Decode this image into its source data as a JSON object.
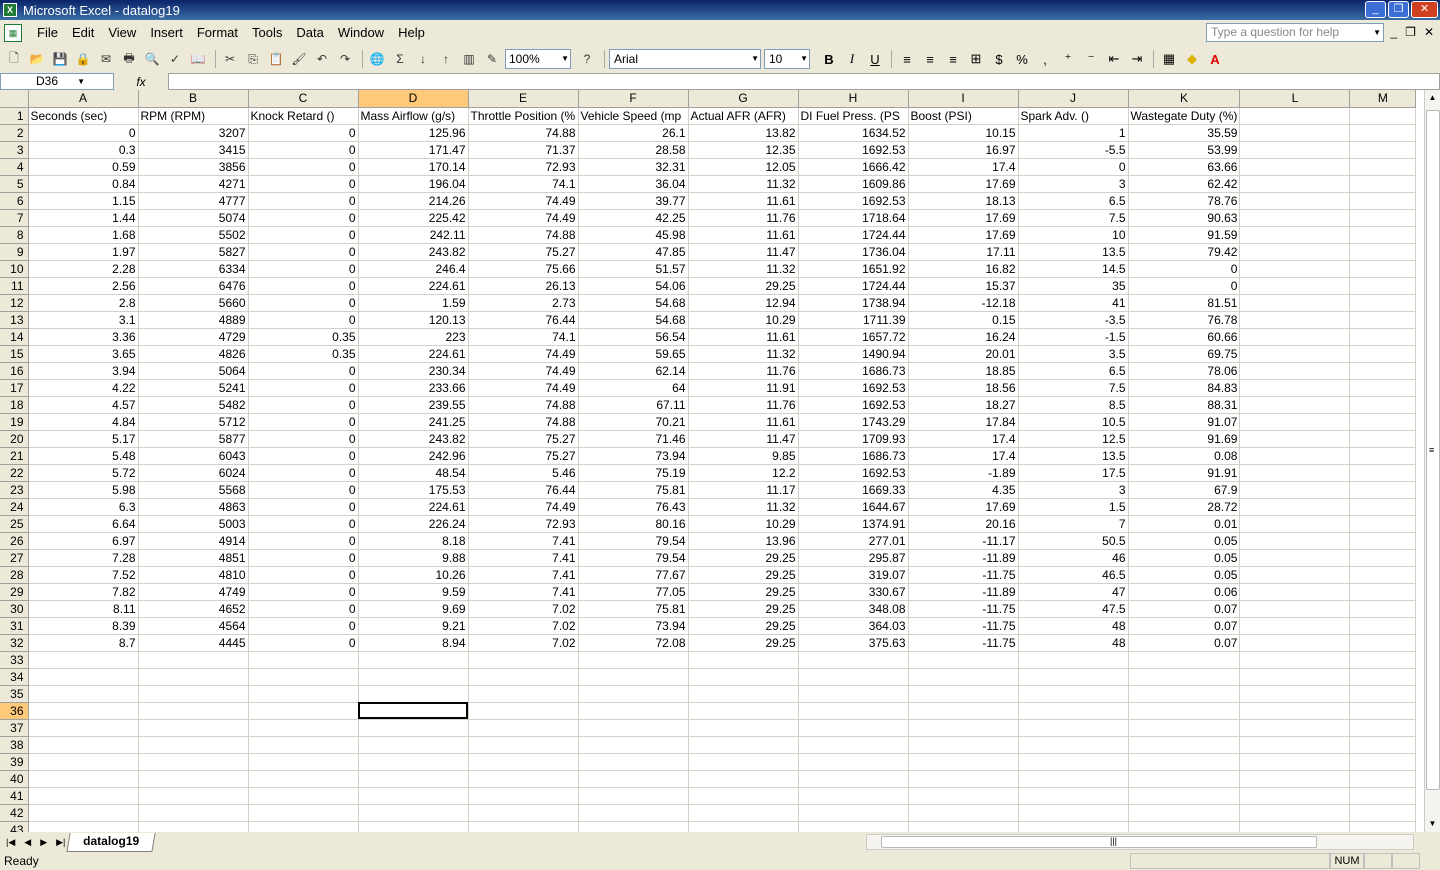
{
  "window": {
    "title": "Microsoft Excel - datalog19"
  },
  "menu": [
    "File",
    "Edit",
    "View",
    "Insert",
    "Format",
    "Tools",
    "Data",
    "Window",
    "Help"
  ],
  "help_placeholder": "Type a question for help",
  "toolbar": {
    "zoom": "100%",
    "font": "Arial",
    "size": "10"
  },
  "formula_bar": {
    "cell_ref": "D36",
    "fx": "fx",
    "content": ""
  },
  "columns": [
    "A",
    "B",
    "C",
    "D",
    "E",
    "F",
    "G",
    "H",
    "I",
    "J",
    "K",
    "L",
    "M"
  ],
  "headers": [
    "Seconds (sec)",
    "RPM (RPM)",
    "Knock Retard ()",
    "Mass Airflow (g/s)",
    "Throttle Position (%",
    "Vehicle Speed (mp",
    "Actual AFR (AFR)",
    "DI Fuel Press. (PS",
    "Boost (PSI)",
    "Spark Adv. ()",
    "Wastegate Duty (%)"
  ],
  "rows": [
    [
      "0",
      "3207",
      "0",
      "125.96",
      "74.88",
      "26.1",
      "13.82",
      "1634.52",
      "10.15",
      "1",
      "35.59"
    ],
    [
      "0.3",
      "3415",
      "0",
      "171.47",
      "71.37",
      "28.58",
      "12.35",
      "1692.53",
      "16.97",
      "-5.5",
      "53.99"
    ],
    [
      "0.59",
      "3856",
      "0",
      "170.14",
      "72.93",
      "32.31",
      "12.05",
      "1666.42",
      "17.4",
      "0",
      "63.66"
    ],
    [
      "0.84",
      "4271",
      "0",
      "196.04",
      "74.1",
      "36.04",
      "11.32",
      "1609.86",
      "17.69",
      "3",
      "62.42"
    ],
    [
      "1.15",
      "4777",
      "0",
      "214.26",
      "74.49",
      "39.77",
      "11.61",
      "1692.53",
      "18.13",
      "6.5",
      "78.76"
    ],
    [
      "1.44",
      "5074",
      "0",
      "225.42",
      "74.49",
      "42.25",
      "11.76",
      "1718.64",
      "17.69",
      "7.5",
      "90.63"
    ],
    [
      "1.68",
      "5502",
      "0",
      "242.11",
      "74.88",
      "45.98",
      "11.61",
      "1724.44",
      "17.69",
      "10",
      "91.59"
    ],
    [
      "1.97",
      "5827",
      "0",
      "243.82",
      "75.27",
      "47.85",
      "11.47",
      "1736.04",
      "17.11",
      "13.5",
      "79.42"
    ],
    [
      "2.28",
      "6334",
      "0",
      "246.4",
      "75.66",
      "51.57",
      "11.32",
      "1651.92",
      "16.82",
      "14.5",
      "0"
    ],
    [
      "2.56",
      "6476",
      "0",
      "224.61",
      "26.13",
      "54.06",
      "29.25",
      "1724.44",
      "15.37",
      "35",
      "0"
    ],
    [
      "2.8",
      "5660",
      "0",
      "1.59",
      "2.73",
      "54.68",
      "12.94",
      "1738.94",
      "-12.18",
      "41",
      "81.51"
    ],
    [
      "3.1",
      "4889",
      "0",
      "120.13",
      "76.44",
      "54.68",
      "10.29",
      "1711.39",
      "0.15",
      "-3.5",
      "76.78"
    ],
    [
      "3.36",
      "4729",
      "0.35",
      "223",
      "74.1",
      "56.54",
      "11.61",
      "1657.72",
      "16.24",
      "-1.5",
      "60.66"
    ],
    [
      "3.65",
      "4826",
      "0.35",
      "224.61",
      "74.49",
      "59.65",
      "11.32",
      "1490.94",
      "20.01",
      "3.5",
      "69.75"
    ],
    [
      "3.94",
      "5064",
      "0",
      "230.34",
      "74.49",
      "62.14",
      "11.76",
      "1686.73",
      "18.85",
      "6.5",
      "78.06"
    ],
    [
      "4.22",
      "5241",
      "0",
      "233.66",
      "74.49",
      "64",
      "11.91",
      "1692.53",
      "18.56",
      "7.5",
      "84.83"
    ],
    [
      "4.57",
      "5482",
      "0",
      "239.55",
      "74.88",
      "67.11",
      "11.76",
      "1692.53",
      "18.27",
      "8.5",
      "88.31"
    ],
    [
      "4.84",
      "5712",
      "0",
      "241.25",
      "74.88",
      "70.21",
      "11.61",
      "1743.29",
      "17.84",
      "10.5",
      "91.07"
    ],
    [
      "5.17",
      "5877",
      "0",
      "243.82",
      "75.27",
      "71.46",
      "11.47",
      "1709.93",
      "17.4",
      "12.5",
      "91.69"
    ],
    [
      "5.48",
      "6043",
      "0",
      "242.96",
      "75.27",
      "73.94",
      "9.85",
      "1686.73",
      "17.4",
      "13.5",
      "0.08"
    ],
    [
      "5.72",
      "6024",
      "0",
      "48.54",
      "5.46",
      "75.19",
      "12.2",
      "1692.53",
      "-1.89",
      "17.5",
      "91.91"
    ],
    [
      "5.98",
      "5568",
      "0",
      "175.53",
      "76.44",
      "75.81",
      "11.17",
      "1669.33",
      "4.35",
      "3",
      "67.9"
    ],
    [
      "6.3",
      "4863",
      "0",
      "224.61",
      "74.49",
      "76.43",
      "11.32",
      "1644.67",
      "17.69",
      "1.5",
      "28.72"
    ],
    [
      "6.64",
      "5003",
      "0",
      "226.24",
      "72.93",
      "80.16",
      "10.29",
      "1374.91",
      "20.16",
      "7",
      "0.01"
    ],
    [
      "6.97",
      "4914",
      "0",
      "8.18",
      "7.41",
      "79.54",
      "13.96",
      "277.01",
      "-11.17",
      "50.5",
      "0.05"
    ],
    [
      "7.28",
      "4851",
      "0",
      "9.88",
      "7.41",
      "79.54",
      "29.25",
      "295.87",
      "-11.89",
      "46",
      "0.05"
    ],
    [
      "7.52",
      "4810",
      "0",
      "10.26",
      "7.41",
      "77.67",
      "29.25",
      "319.07",
      "-11.75",
      "46.5",
      "0.05"
    ],
    [
      "7.82",
      "4749",
      "0",
      "9.59",
      "7.41",
      "77.05",
      "29.25",
      "330.67",
      "-11.89",
      "47",
      "0.06"
    ],
    [
      "8.11",
      "4652",
      "0",
      "9.69",
      "7.02",
      "75.81",
      "29.25",
      "348.08",
      "-11.75",
      "47.5",
      "0.07"
    ],
    [
      "8.39",
      "4564",
      "0",
      "9.21",
      "7.02",
      "73.94",
      "29.25",
      "364.03",
      "-11.75",
      "48",
      "0.07"
    ],
    [
      "8.7",
      "4445",
      "0",
      "8.94",
      "7.02",
      "72.08",
      "29.25",
      "375.63",
      "-11.75",
      "48",
      "0.07"
    ]
  ],
  "active_cell": {
    "col": "D",
    "row": 36
  },
  "sheet_tab": "datalog19",
  "status": {
    "left": "Ready",
    "num": "NUM"
  }
}
